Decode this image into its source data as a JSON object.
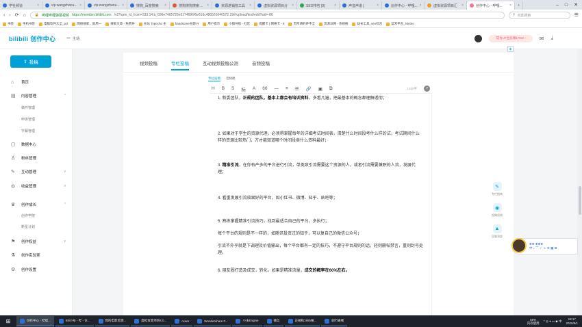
{
  "browser": {
    "tabs": [
      {
        "title": "学社频道",
        "color": "b"
      },
      {
        "title": "vip.wangzhanu...",
        "color": "b"
      },
      {
        "title": "vip.wangzhanu...",
        "color": "b"
      },
      {
        "title": "搜狗_百度搜索",
        "color": "b"
      },
      {
        "title": "搜狗搜狗搜索 ...",
        "color": "r"
      },
      {
        "title": "资源进销管工具",
        "color": "b"
      },
      {
        "title": "虚拟资源项目分",
        "color": "b"
      },
      {
        "title": "SEO排名 [9]",
        "color": "g"
      },
      {
        "title": "声音声道 [",
        "color": "b"
      },
      {
        "title": "创作中心 - 哔哩...",
        "color": "b"
      },
      {
        "title": "虚拟资源项目汇",
        "color": "o"
      },
      {
        "title": "创作中心 - 哔哩...",
        "color": "p",
        "active": true
      }
    ],
    "new_tab": "+",
    "nav": {
      "back": "‹",
      "forward": "›",
      "reload": "⟳",
      "home": "⌂"
    },
    "url_host": "https://member.bilibili.com",
    "url_path": "/v2?spm_id_from=333.14.b_696e7465726e6174696f6e616c486561646572.29#/upload/text/edit?aid=-86",
    "secure_label": "哔哩哔哩弹幕视频",
    "search_placeholder": "点此搜索",
    "bookmarks": [
      "书签",
      "手机书签",
      "电脑软件大全_pcl",
      "网盘搜索，就用一",
      "搜索文章 - 免费导",
      "主站 Typecho 主",
      "handsome主题 R",
      "用户提示",
      "小猿导航 - 社区",
      "提醒卡 | 网络卡 - 8",
      "无所谓的开不全",
      "资源派网 - 热榜搜",
      "站长工具_seo综合",
      "蓝禾平台_Ninteo"
    ]
  },
  "header": {
    "logo": "bilibili 创作中心",
    "home_label": "主站",
    "promo": "成为UP主此赚176W ›",
    "mail_badge": "3"
  },
  "sidebar": {
    "post_button": "投稿",
    "items": [
      {
        "label": "首页",
        "icon": "⌂"
      },
      {
        "label": "内容管理",
        "icon": "▤",
        "chev": "^"
      },
      {
        "label": "数据中心",
        "icon": "▢"
      },
      {
        "label": "粉丝管理",
        "icon": "♙"
      },
      {
        "label": "互动管理",
        "icon": "✎",
        "chev": "v"
      },
      {
        "label": "收益管理",
        "icon": "◎",
        "chev": "v"
      },
      {
        "label": "创作成长",
        "icon": "♛",
        "chev": "^"
      },
      {
        "label": "创作权益",
        "icon": "⚑",
        "chev": "v"
      },
      {
        "label": "创作实验室",
        "icon": "⚗"
      },
      {
        "label": "创作设置",
        "icon": "⚙"
      }
    ],
    "sub_content": [
      "稿件管理",
      "申诉管理",
      "字幕管理"
    ],
    "sub_growth": [
      "创作学院",
      "新星计划"
    ]
  },
  "content": {
    "tabs": [
      "视频投稿",
      "专栏投稿",
      "互动视频投稿公测",
      "音频投稿"
    ],
    "editor_modes": [
      "专栏投稿",
      "音频稿"
    ],
    "toolbar": [
      "H",
      "B",
      "S",
      "标",
      "A",
      "66",
      "—",
      "≡",
      "☰",
      "🔗",
      "▣",
      "⧉"
    ],
    "word_count": "1560字",
    "paragraphs": [
      {
        "id": "p1",
        "runs": [
          {
            "t": "1. 新委团队，"
          },
          {
            "t": "正规的团队，基本上都会有培训资料",
            "b": true
          },
          {
            "t": "，多看几遍，把最基本的概念都理解透彻；"
          }
        ]
      },
      {
        "id": "p2",
        "runs": [
          {
            "t": "2. 如果对于学生的资源代理，必须得掌握每年的详细考试时间表，清楚什么时间段考什么样的试，考试期间什么样的资源比较热门，方才能知道哪个时间段卖什么资料最好；"
          }
        ]
      },
      {
        "id": "p3",
        "runs": [
          {
            "t": "3. "
          },
          {
            "t": "精准引流",
            "b": true
          },
          {
            "t": "，在你有产多的平台进行引流，单类致引流需要这个资源的人，或者引流需要兼职的人流，发展代理；"
          }
        ]
      },
      {
        "id": "p4",
        "runs": [
          {
            "t": "4. 看重发展引流效果好的平台，如小红书、微博、知乎、贴吧等；"
          }
        ]
      },
      {
        "id": "p5",
        "runs": [
          {
            "t": "5. 熟练掌握精准引流技巧，找到最适合自己的平台，多执行；"
          }
        ]
      },
      {
        "id": "p6",
        "runs": [
          {
            "t": "每个平台的规则是不一样的，如随讯投资过的知乎，可以复自己的微信公众号；"
          }
        ]
      },
      {
        "id": "p7",
        "runs": [
          {
            "t": "引流不外乎就是下调理及价值输出，每个平台都有一定的技巧，不遵守平台规则的话，轻则删帖禁言，重则封号处理。"
          }
        ]
      },
      {
        "id": "p8",
        "runs": [
          {
            "t": "6. 朋友圈打造及成交，转化，如果是精准流量，"
          },
          {
            "t": "成交的概率在60%左右。",
            "b": true
          }
        ]
      }
    ]
  },
  "right_panel": [
    {
      "label": "专栏指南",
      "icon": "✎"
    },
    {
      "label": "投稿须知",
      "icon": "◉"
    },
    {
      "label": "回到顶部",
      "icon": "▲"
    }
  ],
  "ime": {
    "label": "中 ♪ ⌒ ✓ ☺ ⚙ ▦ ⊞",
    "name": "❀❀ ❀❀❀"
  },
  "taskbar": {
    "start": "⊞",
    "apps": [
      "创作中心 - 哔哩...",
      "Bili小号 - 哔 - 论...",
      "我的电影资源...",
      "虚拟资源项目4.0...",
      "ocam",
      "Wondershare F...",
      "小玉Engine",
      "微信",
      "正规机1995搜...",
      "剧行查看"
    ],
    "mem": "55%",
    "mem_label": "内存使用",
    "tray_icons": "^ ◎ ♦ ▭ ◆ 中",
    "time": "18:17",
    "date": "2020/9/1"
  }
}
